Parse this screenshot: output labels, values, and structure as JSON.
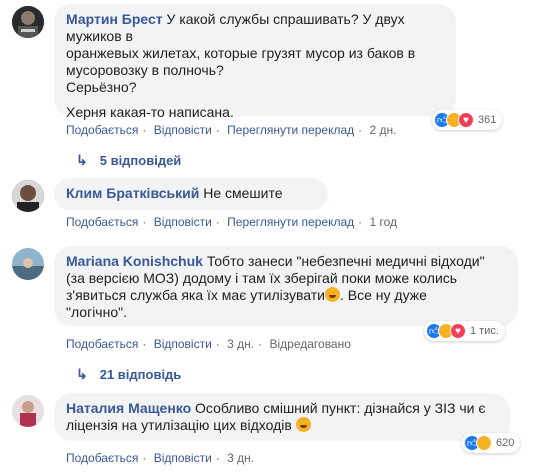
{
  "comments": [
    {
      "author": "Мартин Брест",
      "lines": [
        "У какой службы спрашивать? У двух мужиков в",
        "оранжевых жилетах, которые грузят мусор из баков в",
        "мусоровозку в полночь?",
        "Серьёзно?",
        "",
        "Херня какая-то написана."
      ],
      "actions": {
        "like": "Подобається",
        "reply": "Відповісти",
        "translate": "Переглянути переклад",
        "time": "2 дн."
      },
      "reactions": {
        "count": "361"
      },
      "replies": "5 відповідей"
    },
    {
      "author": "Клим Братківський",
      "text": "Не смешите",
      "actions": {
        "like": "Подобається",
        "reply": "Відповісти",
        "translate": "Переглянути переклад",
        "time": "1 год"
      }
    },
    {
      "author": "Mariana Konishchuk",
      "lines": [
        "Тобто занеси \"небезпечні медичні відходи\"",
        "(за версією МОЗ) додому і там їх зберігай поки може колись",
        "з'явиться служба яка їх має утилізувати",
        ". Все ну дуже",
        "\"логічно\"."
      ],
      "actions": {
        "like": "Подобається",
        "reply": "Відповісти",
        "time": "3 дн.",
        "edited": "Відредаговано"
      },
      "reactions": {
        "count": "1 тис."
      },
      "replies": "21 відповідь"
    },
    {
      "author": "Наталия Мащенко",
      "lines": [
        "Особливо смішний пункт: дізнайся у ЗІЗ чи є",
        "ліцензія на утилізацію цих відходів"
      ],
      "actions": {
        "like": "Подобається",
        "reply": "Відповісти",
        "time": "3 дн."
      },
      "reactions": {
        "count": "620"
      }
    }
  ],
  "icons": {
    "like": "thumbs-up-icon",
    "haha": "laughing-face-icon",
    "love": "heart-icon",
    "reply_arrow": "reply-arrow-icon"
  },
  "colors": {
    "link": "#385898",
    "bubble": "#f2f3f5",
    "like": "#1877f2",
    "haha": "#f7b125",
    "love": "#f33e58"
  }
}
